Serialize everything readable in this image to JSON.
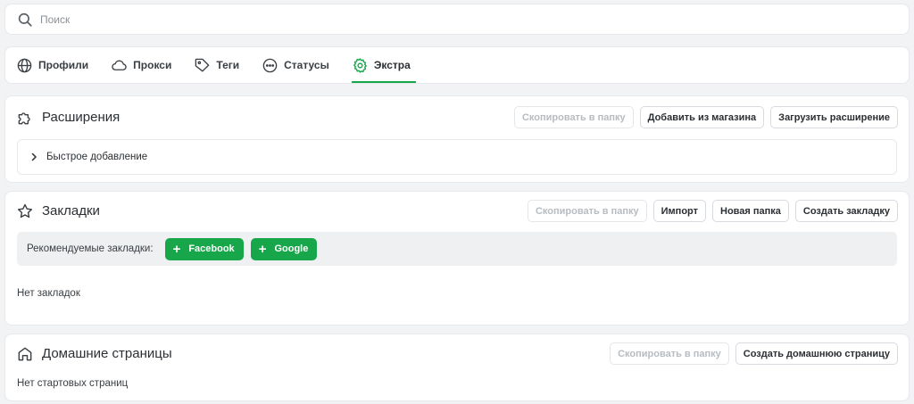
{
  "search": {
    "placeholder": "Поиск",
    "icon": "search-icon"
  },
  "tabs": [
    {
      "label": "Профили",
      "icon": "globe-icon"
    },
    {
      "label": "Прокси",
      "icon": "cloud-icon"
    },
    {
      "label": "Теги",
      "icon": "tag-icon"
    },
    {
      "label": "Статусы",
      "icon": "status-dots-icon"
    },
    {
      "label": "Экстра",
      "icon": "gear-icon",
      "active": true
    }
  ],
  "extensions": {
    "title": "Расширения",
    "icon": "puzzle-icon",
    "buttons": {
      "copy": "Скопировать в папку",
      "add_store": "Добавить из магазина",
      "upload": "Загрузить расширение"
    },
    "quick_add": "Быстрое добавление"
  },
  "bookmarks": {
    "title": "Закладки",
    "icon": "star-icon",
    "buttons": {
      "copy": "Скопировать в папку",
      "import": "Импорт",
      "new_folder": "Новая папка",
      "create": "Создать закладку"
    },
    "recommended_label": "Рекомендуемые закладки:",
    "recommended": [
      "Facebook",
      "Google"
    ],
    "empty": "Нет закладок"
  },
  "homepages": {
    "title": "Домашние страницы",
    "icon": "home-icon",
    "buttons": {
      "copy": "Скопировать в папку",
      "create": "Создать домашнюю страницу"
    },
    "empty": "Нет стартовых страниц"
  },
  "colors": {
    "accent": "#17a74a",
    "background": "#f2f3f4"
  }
}
